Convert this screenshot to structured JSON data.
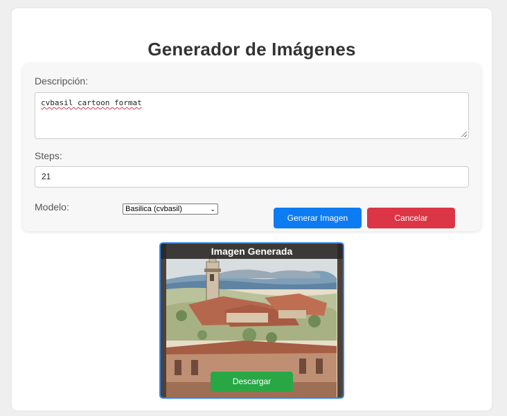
{
  "page": {
    "title": "Generador de Imágenes"
  },
  "form": {
    "description_label": "Descripción:",
    "description_value": "cvbasil cartoon format",
    "steps_label": "Steps:",
    "steps_value": "21",
    "model_label": "Modelo:",
    "model_selected": "Basilica (cvbasil)",
    "generate_label": "Generar Imagen",
    "cancel_label": "Cancelar"
  },
  "result": {
    "header": "Imagen Generada",
    "download_label": "Descargar"
  },
  "colors": {
    "primary": "#0d7cf2",
    "danger": "#dc3545",
    "success": "#28a745"
  }
}
